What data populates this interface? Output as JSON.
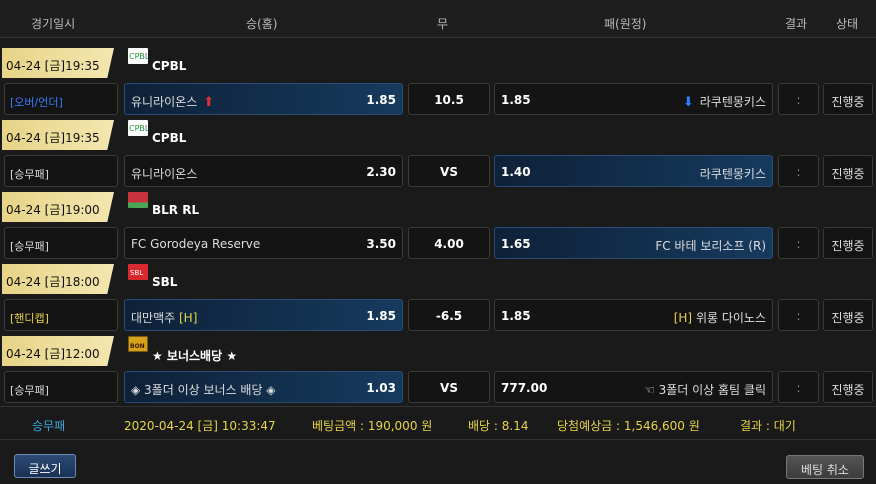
{
  "header": {
    "col_date": "경기일시",
    "col_home": "승(홈)",
    "col_draw": "무",
    "col_away": "패(원정)",
    "col_result": "결과",
    "col_status": "상태"
  },
  "games": [
    {
      "date": "04-24 [금]19:35",
      "league": "CPBL",
      "bet_type": "[오버/언더]",
      "home_team": "유니라이온스",
      "home_odds": "1.85",
      "draw": "10.5",
      "away_odds": "1.85",
      "away_team": "라쿠텐몽키스",
      "result": ":",
      "status": "진행중"
    },
    {
      "date": "04-24 [금]19:35",
      "league": "CPBL",
      "bet_type": "[승무패]",
      "home_team": "유니라이온스",
      "home_odds": "2.30",
      "draw": "VS",
      "away_odds": "1.40",
      "away_team": "라쿠텐몽키스",
      "result": ":",
      "status": "진행중"
    },
    {
      "date": "04-24 [금]19:00",
      "league": "BLR RL",
      "bet_type": "[승무패]",
      "home_team": "FC Gorodeya Reserve",
      "home_odds": "3.50",
      "draw": "4.00",
      "away_odds": "1.65",
      "away_team": "FC 바테 보리소프 (R)",
      "result": ":",
      "status": "진행중"
    },
    {
      "date": "04-24 [금]18:00",
      "league": "SBL",
      "bet_type": "[핸디캡]",
      "home_team": "대만맥주",
      "home_mark": "[H]",
      "home_odds": "1.85",
      "draw": "-6.5",
      "away_odds": "1.85",
      "away_mark": "[H]",
      "away_team": "위롱 다이노스",
      "result": ":",
      "status": "진행중"
    },
    {
      "date": "04-24 [금]12:00",
      "league": "★ 보너스배당 ★",
      "bet_type": "[승무패]",
      "home_team": "◈ 3폴더 이상 보너스 배당 ◈",
      "home_odds": "1.03",
      "draw": "VS",
      "away_odds": "777.00",
      "away_team": "☜ 3폴더 이상 홈팀 클릭",
      "result": ":",
      "status": "진행중"
    }
  ],
  "footer": {
    "type": "승무패",
    "datetime": "2020-04-24 [금] 10:33:47",
    "bet_amount": "베팅금액 : 190,000 원",
    "odds": "배당 : 8.14",
    "expected": "당첨예상금 : 1,546,600 원",
    "result": "결과 : 대기"
  },
  "buttons": {
    "write": "글쓰기",
    "cancel": "베팅 취소"
  },
  "colors": {
    "accent_gold": "#e8d488",
    "selected_blue": "#163a5e",
    "up_red": "#e03030",
    "down_blue": "#2f7bff"
  }
}
